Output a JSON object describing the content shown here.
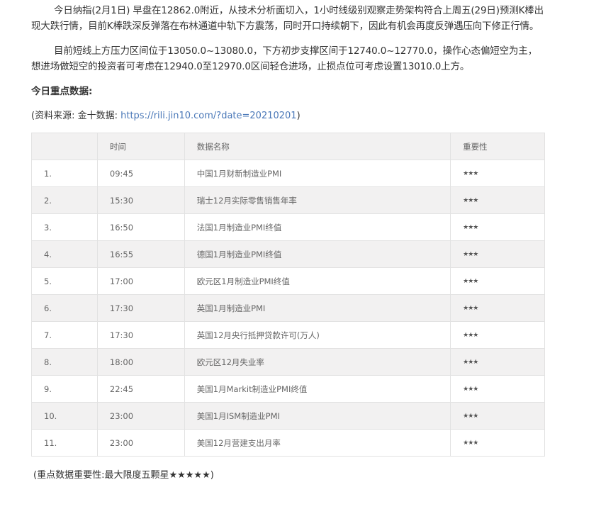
{
  "paragraphs": [
    "今日纳指(2月1日) 早盘在12862.0附近，从技术分析面切入，1小时线级别观察走势架构符合上周五(29日)预测K棒出现大跌行情，目前K棒跌深反弹落在布林通道中轨下方震荡，同时开口持续朝下，因此有机会再度反弹遇压向下修正行情。",
    "目前短线上方压力区间位于13050.0~13080.0，下方初步支撑区间于12740.0~12770.0，操作心态偏短空为主，想进场做短空的投资者可考虑在12940.0至12970.0区间轻仓进场，止损点位可考虑设置13010.0上方。"
  ],
  "heading": "今日重点数据:",
  "source": {
    "prefix": "(资料来源: 金十数据: ",
    "link": "https://rili.jin10.com/?date=20210201",
    "suffix": ")"
  },
  "table": {
    "headers": [
      "",
      "时间",
      "数据名称",
      "重要性"
    ],
    "rows": [
      [
        "1.",
        "09:45",
        "中国1月财新制造业PMI",
        "★★★"
      ],
      [
        "2.",
        "15:30",
        "瑞士12月实际零售销售年率",
        "★★★"
      ],
      [
        "3.",
        "16:50",
        "法国1月制造业PMI终值",
        "★★★"
      ],
      [
        "4.",
        "16:55",
        "德国1月制造业PMI终值",
        "★★★"
      ],
      [
        "5.",
        "17:00",
        "欧元区1月制造业PMI终值",
        "★★★"
      ],
      [
        "6.",
        "17:30",
        "英国1月制造业PMI",
        "★★★"
      ],
      [
        "7.",
        "17:30",
        "英国12月央行抵押贷款许可(万人)",
        "★★★"
      ],
      [
        "8.",
        "18:00",
        "欧元区12月失业率",
        "★★★"
      ],
      [
        "9.",
        "22:45",
        "美国1月Markit制造业PMI终值",
        "★★★"
      ],
      [
        "10.",
        "23:00",
        "美国1月ISM制造业PMI",
        "★★★"
      ],
      [
        "11.",
        "23:00",
        "美国12月营建支出月率",
        "★★★"
      ]
    ]
  },
  "footer": "(重点数据重要性:最大限度五颗星★★★★★)"
}
